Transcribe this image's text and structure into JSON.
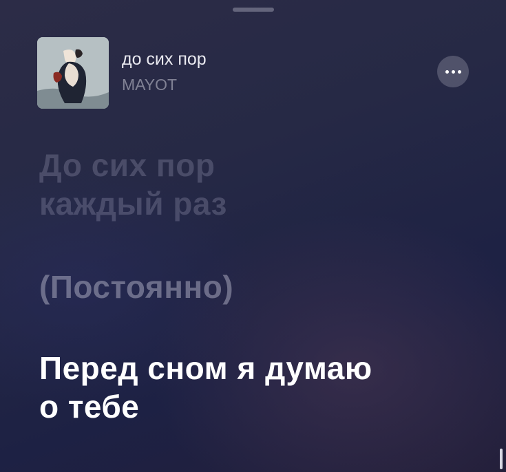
{
  "now_playing": {
    "title": "до сих пор",
    "artist": "MAYOT",
    "artwork_icon": "album-cover-embracing-couple"
  },
  "controls": {
    "more_icon": "ellipsis-icon"
  },
  "lyrics": {
    "block_1": [
      "До сих пор",
      "каждый раз"
    ],
    "block_2": [
      "(Постоянно)"
    ],
    "block_3": [
      "Перед сном я думаю",
      "о тебе"
    ]
  },
  "colors": {
    "background": "#262945",
    "active_lyric": "#ffffff",
    "inactive_lyric": "#5d5f80"
  }
}
